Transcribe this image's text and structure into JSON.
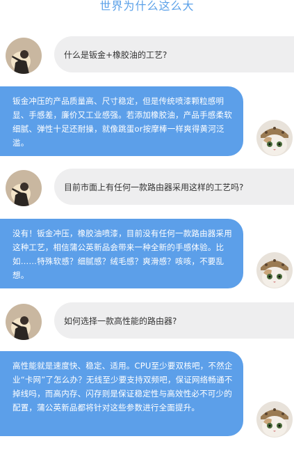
{
  "title": "世界为什么这么大",
  "chat": [
    {
      "role": "q",
      "text": "什么是钣金+橡胶油的工艺?"
    },
    {
      "role": "a",
      "text": "钣金冲压的产品质量高、尺寸稳定，但是传统喷漆颗粒感明显、手感差，廉价又工业感强。若添加橡胶油，产品手感柔软细腻、弹性十足还耐操，就像跳蛋or按摩棒一样爽得黄河泛滥。"
    },
    {
      "role": "q",
      "text": "目前市面上有任何一款路由器采用这样的工艺吗?"
    },
    {
      "role": "a",
      "text": "没有！钣金冲压，橡胶油喷漆，目前没有任何一款路由器采用这种工艺，相信蒲公英新品会带来一种全新的手感体验。比如……特殊软感？细腻感？绒毛感？爽滑感？咳咳，不要乱想。"
    },
    {
      "role": "q",
      "text": "如何选择一款高性能的路由器?"
    },
    {
      "role": "a",
      "text": "高性能就是速度快、稳定、适用。CPU至少要双核吧，不然企业“卡网”了怎么办？无线至少要支持双频吧，保证网络畅通不掉线吗，而高内存、闪存则是保证稳定性与高效性必不可少的配置，蒲公英新品都将针对这些参数进行全面提升。"
    }
  ]
}
